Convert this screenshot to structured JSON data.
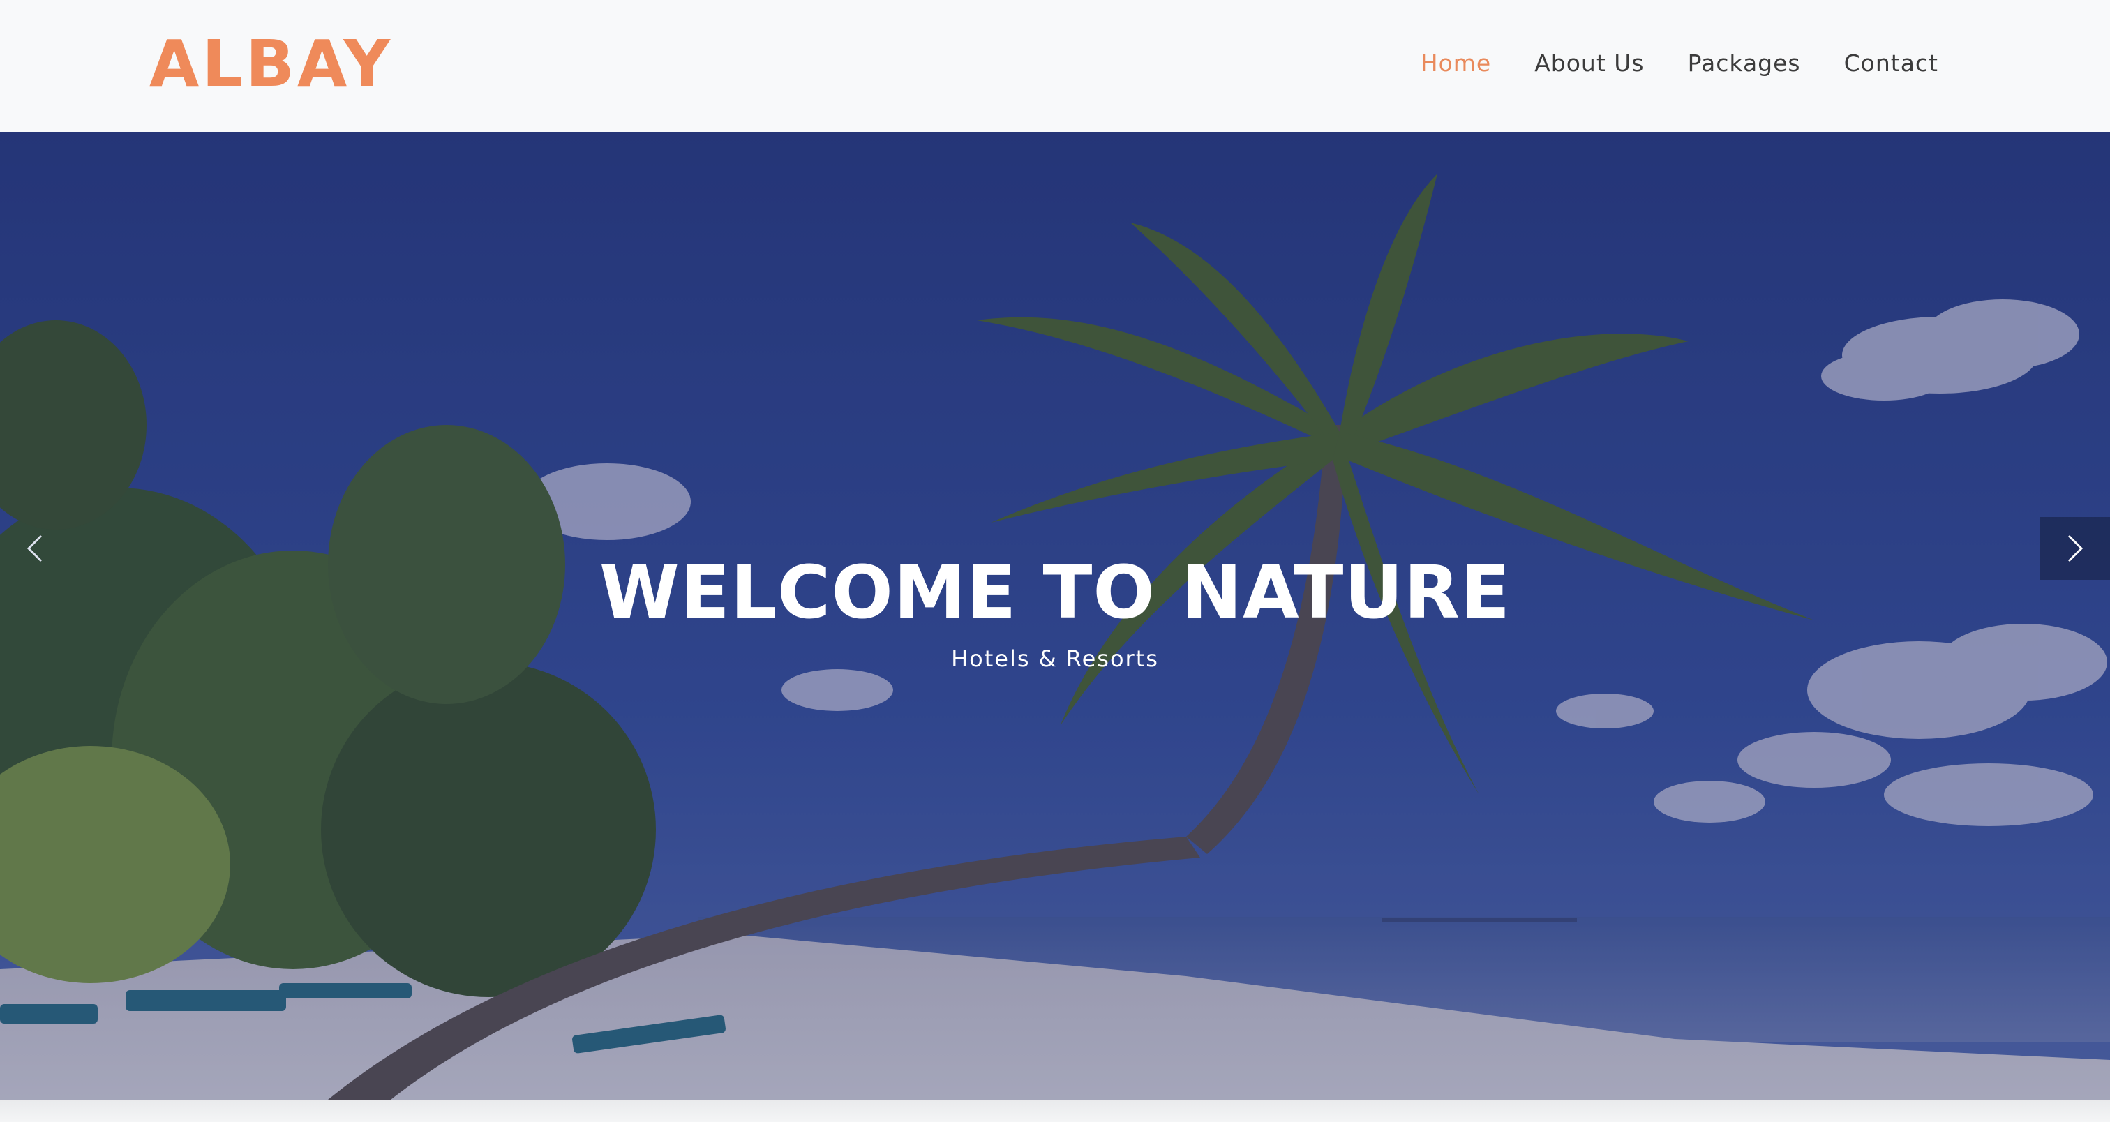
{
  "brand": {
    "name": "ALBAY"
  },
  "nav": {
    "items": [
      {
        "label": "Home",
        "active": true
      },
      {
        "label": "About Us",
        "active": false
      },
      {
        "label": "Packages",
        "active": false
      },
      {
        "label": "Contact",
        "active": false
      }
    ]
  },
  "hero": {
    "title": "WELCOME TO NATURE",
    "subtitle": "Hotels & Resorts"
  },
  "icons": {
    "prev": "chevron-left-icon",
    "next": "chevron-right-icon"
  },
  "colors": {
    "brand": "#ef8a5a",
    "nav_active": "#e98a5c",
    "nav_text": "#3c3c3c",
    "sky": "#2f4380"
  }
}
